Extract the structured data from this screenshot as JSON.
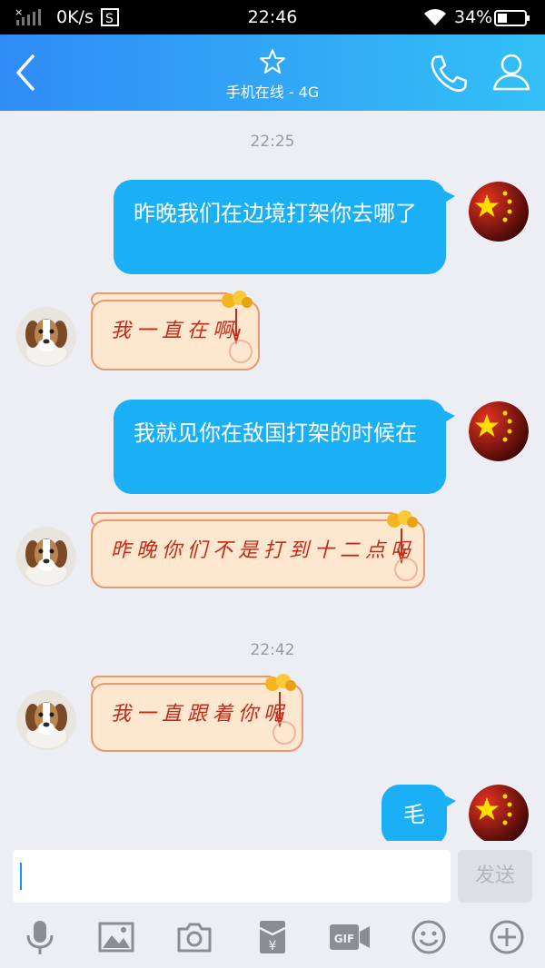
{
  "status_bar": {
    "network_speed": "0K/s",
    "time": "22:46",
    "battery": "34%"
  },
  "header": {
    "subtitle": "手机在线 - 4G",
    "icons": [
      "back-arrow-icon",
      "star-icon",
      "phone-icon",
      "contact-icon"
    ]
  },
  "messages": [
    {
      "type": "timestamp",
      "text": "22:25"
    },
    {
      "type": "outgoing",
      "text": "昨晚我们在边境打架你去哪了"
    },
    {
      "type": "incoming",
      "text": "我一直在啊"
    },
    {
      "type": "outgoing",
      "text": "我就见你在敌国打架的时候在"
    },
    {
      "type": "incoming",
      "text": "昨晚你们不是打到十二点吗"
    },
    {
      "type": "timestamp",
      "text": "22:42"
    },
    {
      "type": "incoming",
      "text": "我一直跟着你呢"
    },
    {
      "type": "outgoing",
      "text": "毛"
    }
  ],
  "input_bar": {
    "value": "",
    "send_label": "发送"
  },
  "toolbar": [
    "microphone-icon",
    "image-icon",
    "camera-icon",
    "red-packet-icon",
    "gif-icon",
    "emoji-icon",
    "plus-icon"
  ],
  "colors": {
    "header_start": "#2f8cf7",
    "header_end": "#33c0f6",
    "outgoing_bubble": "#1bb0f5",
    "background": "#eceef4",
    "scroll_text": "#c52a18"
  }
}
